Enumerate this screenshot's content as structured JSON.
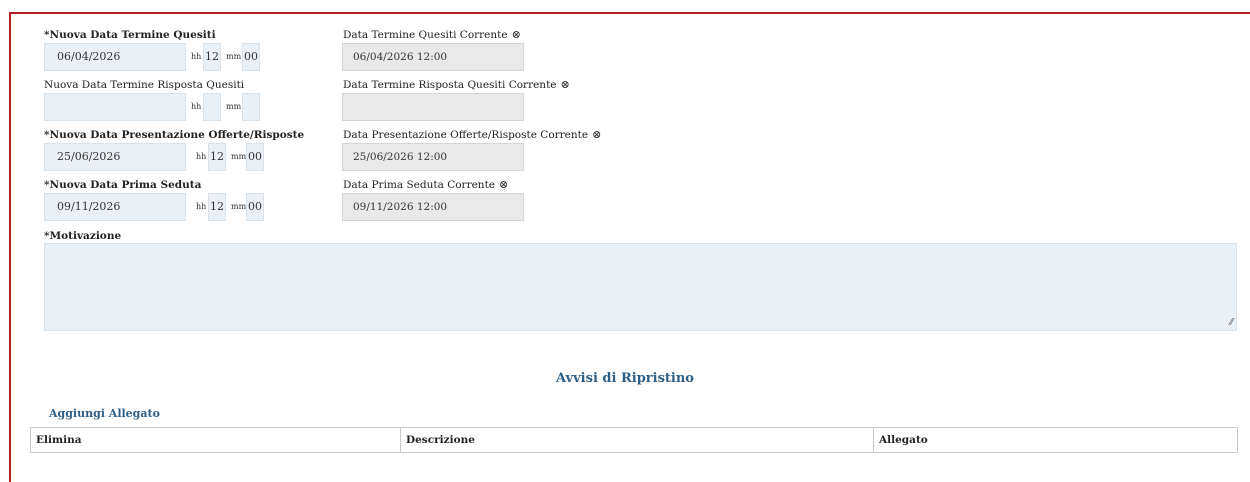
{
  "rows": [
    {
      "new_label": "*Nuova Data Termine Quesiti",
      "new_date": "06/04/2026",
      "hh_label": "hh",
      "hh": "12",
      "mm_label": "mm",
      "mm": "00",
      "current_label": "Data Termine Quesiti Corrente",
      "current_value": "06/04/2026 12:00"
    },
    {
      "new_label": "Nuova Data Termine Risposta Quesiti",
      "new_date": "",
      "hh_label": "hh",
      "hh": "",
      "mm_label": "mm",
      "mm": "",
      "current_label": "Data Termine Risposta Quesiti Corrente",
      "current_value": ""
    },
    {
      "new_label": "*Nuova Data Presentazione Offerte/Risposte",
      "new_date": "25/06/2026",
      "hh_label": "hh",
      "hh": "12",
      "mm_label": "mm",
      "mm": "00",
      "current_label": "Data Presentazione Offerte/Risposte Corrente",
      "current_value": "25/06/2026 12:00"
    },
    {
      "new_label": "*Nuova Data Prima Seduta",
      "new_date": "09/11/2026",
      "hh_label": "hh",
      "hh": "12",
      "mm_label": "mm",
      "mm": "00",
      "current_label": "Data Prima Seduta Corrente",
      "current_value": "09/11/2026 12:00"
    }
  ],
  "clear_glyph": "⊗",
  "motivazione": {
    "label": "*Motivazione",
    "value": ""
  },
  "resize_glyph": "⁄⁄",
  "section": {
    "title": "Avvisi di Ripristino",
    "add_link": "Aggiungi Allegato",
    "columns": [
      "Elimina",
      "Descrizione",
      "Allegato"
    ]
  },
  "colors": {
    "border_accent": "#b22222",
    "link": "#2e5f86",
    "input_bg": "#eaf1f6",
    "readonly_bg": "#e9e9e9"
  }
}
